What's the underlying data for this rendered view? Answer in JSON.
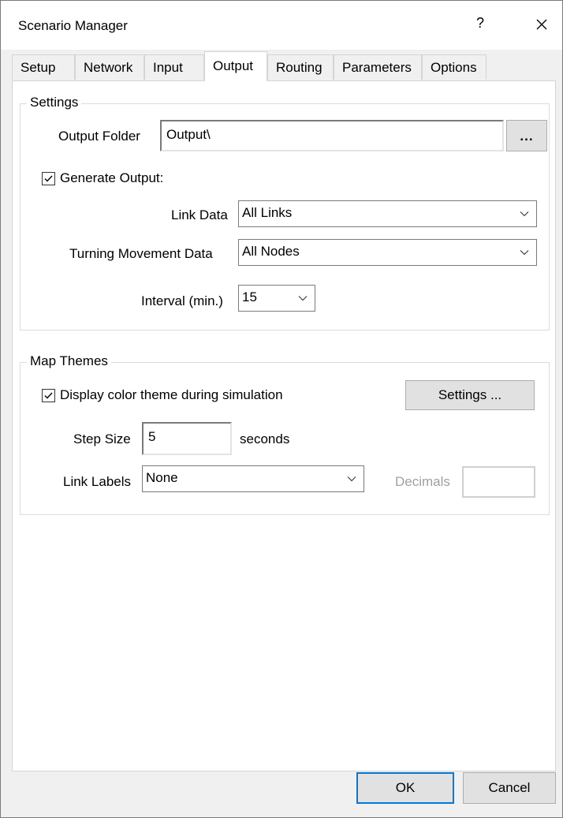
{
  "window": {
    "title": "Scenario Manager",
    "help_label": "?"
  },
  "tabs": [
    {
      "label": "Setup",
      "active": false
    },
    {
      "label": "Network",
      "active": false
    },
    {
      "label": "Input",
      "active": false
    },
    {
      "label": "Output",
      "active": true
    },
    {
      "label": "Routing",
      "active": false
    },
    {
      "label": "Parameters",
      "active": false
    },
    {
      "label": "Options",
      "active": false
    }
  ],
  "settings": {
    "group_label": "Settings",
    "output_folder_label": "Output Folder",
    "output_folder_value": "Output\\",
    "browse_label": "...",
    "generate_output_label": "Generate Output:",
    "generate_output_checked": true,
    "link_data_label": "Link Data",
    "link_data_value": "All Links",
    "turning_movement_label": "Turning Movement Data",
    "turning_movement_value": "All Nodes",
    "interval_label": "Interval (min.)",
    "interval_value": "15"
  },
  "map_themes": {
    "group_label": "Map Themes",
    "display_color_label": "Display color theme during simulation",
    "display_color_checked": true,
    "settings_button_label": "Settings ...",
    "step_size_label": "Step Size",
    "step_size_value": "5",
    "step_size_unit": "seconds",
    "link_labels_label": "Link Labels",
    "link_labels_value": "None",
    "decimals_label": "Decimals",
    "decimals_value": ""
  },
  "footer": {
    "ok_label": "OK",
    "cancel_label": "Cancel"
  },
  "colors": {
    "accent": "#0078d7",
    "panel_bg": "#ffffff",
    "window_bg": "#f0f0f0"
  }
}
